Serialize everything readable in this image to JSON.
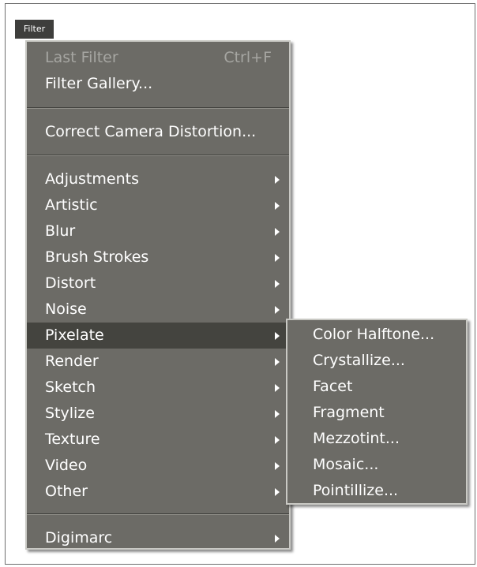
{
  "menubar": {
    "filter_label": "Filter"
  },
  "menu": {
    "last_filter": {
      "label": "Last Filter",
      "shortcut": "Ctrl+F"
    },
    "filter_gallery": "Filter Gallery...",
    "correct_camera": "Correct Camera Distortion...",
    "categories": [
      "Adjustments",
      "Artistic",
      "Blur",
      "Brush Strokes",
      "Distort",
      "Noise",
      "Pixelate",
      "Render",
      "Sketch",
      "Stylize",
      "Texture",
      "Video",
      "Other"
    ],
    "digimarc": "Digimarc"
  },
  "submenu": {
    "items": [
      "Color Halftone...",
      "Crystallize...",
      "Facet",
      "Fragment",
      "Mezzotint...",
      "Mosaic...",
      "Pointillize..."
    ]
  }
}
